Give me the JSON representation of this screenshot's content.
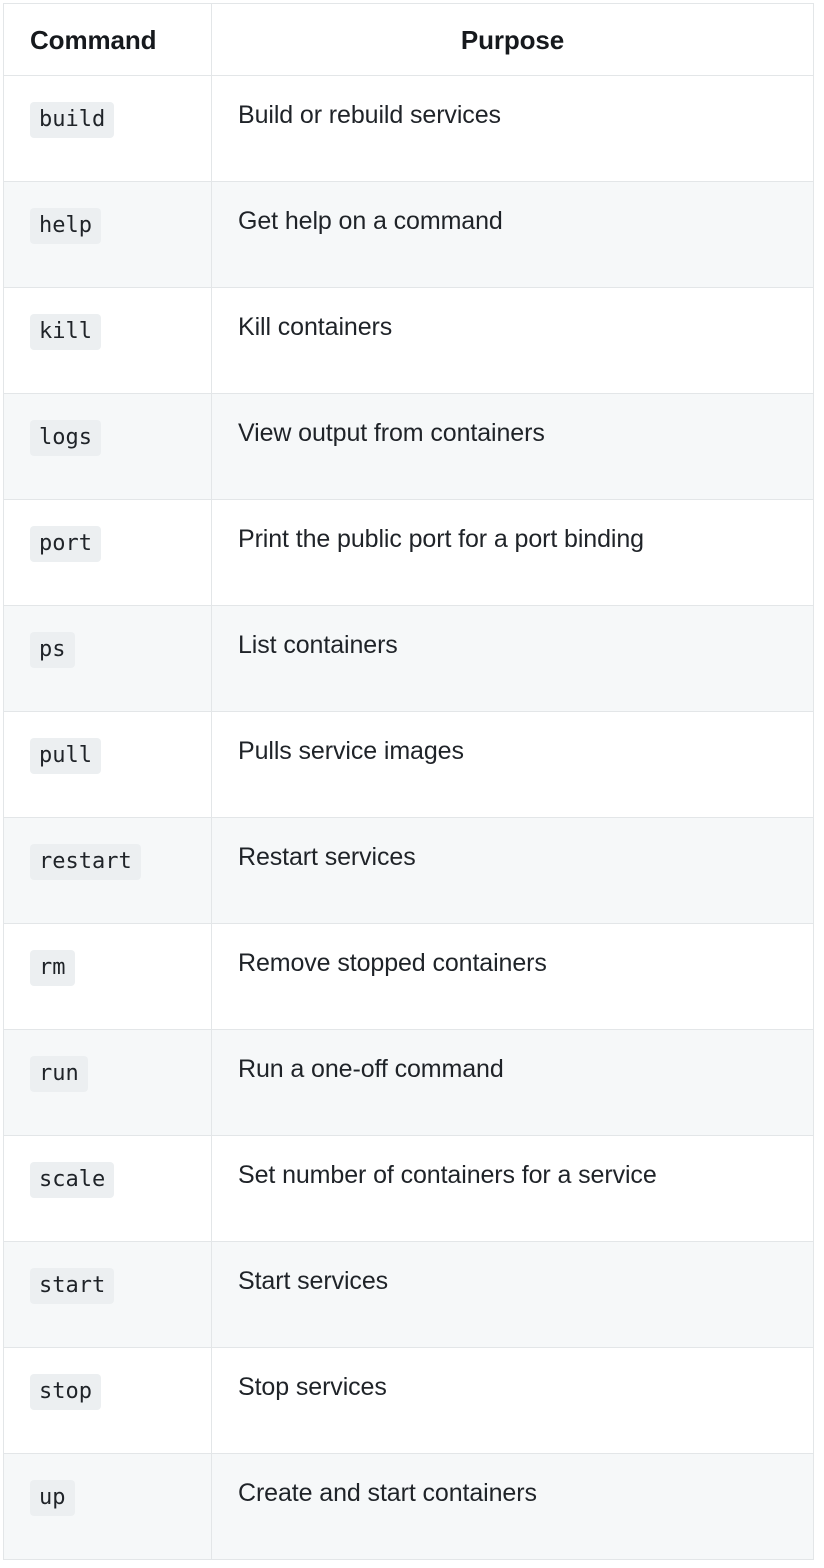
{
  "table": {
    "columns": [
      {
        "key": "command",
        "label": "Command",
        "align": "left"
      },
      {
        "key": "purpose",
        "label": "Purpose",
        "align": "center"
      }
    ],
    "rows": [
      {
        "command": "build",
        "purpose": "Build or rebuild services"
      },
      {
        "command": "help",
        "purpose": "Get help on a command"
      },
      {
        "command": "kill",
        "purpose": "Kill containers"
      },
      {
        "command": "logs",
        "purpose": "View output from containers"
      },
      {
        "command": "port",
        "purpose": "Print the public port for a port binding"
      },
      {
        "command": "ps",
        "purpose": "List containers"
      },
      {
        "command": "pull",
        "purpose": "Pulls service images"
      },
      {
        "command": "restart",
        "purpose": "Restart services"
      },
      {
        "command": "rm",
        "purpose": "Remove stopped containers"
      },
      {
        "command": "run",
        "purpose": "Run a one-off command"
      },
      {
        "command": "scale",
        "purpose": "Set number of containers for a service"
      },
      {
        "command": "start",
        "purpose": "Start services"
      },
      {
        "command": "stop",
        "purpose": "Stop services"
      },
      {
        "command": "up",
        "purpose": "Create and start containers"
      }
    ]
  },
  "style": {
    "border_color": "#e3e6e8",
    "stripe_background": "#f6f8f9",
    "row_background": "#ffffff",
    "badge_background": "#eceff1",
    "text_color": "#1f2328",
    "header_text_color": "#16191d"
  }
}
